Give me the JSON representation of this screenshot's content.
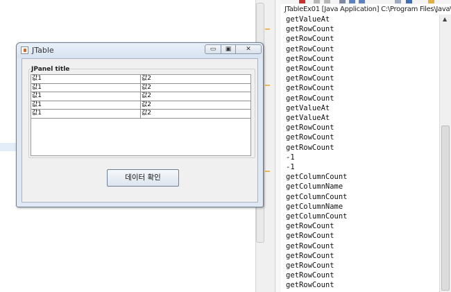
{
  "console": {
    "title": "JTableEx01 [Java Application] C:\\Program Files\\Java\\j",
    "lines": [
      "getValueAt",
      "getRowCount",
      "getRowCount",
      "getRowCount",
      "getRowCount",
      "getRowCount",
      "getRowCount",
      "getRowCount",
      "getRowCount",
      "getValueAt",
      "getValueAt",
      "getRowCount",
      "getRowCount",
      "getRowCount",
      "-1",
      "-1",
      "getColumnCount",
      "getColumnName",
      "getColumnCount",
      "getColumnName",
      "getColumnCount",
      "getRowCount",
      "getRowCount",
      "getRowCount",
      "getRowCount",
      "getRowCount",
      "getRowCount",
      "getRowCount"
    ]
  },
  "window": {
    "title": "JTable",
    "minimize_glyph": "▭",
    "maximize_glyph": "▣",
    "close_glyph": "✕",
    "panel_title": "JPanel title",
    "rows": [
      [
        "값1",
        "값2"
      ],
      [
        "값1",
        "값2"
      ],
      [
        "값1",
        "값2"
      ],
      [
        "값1",
        "값2"
      ],
      [
        "값1",
        "값2"
      ]
    ],
    "button_label": "데이터 확인"
  }
}
